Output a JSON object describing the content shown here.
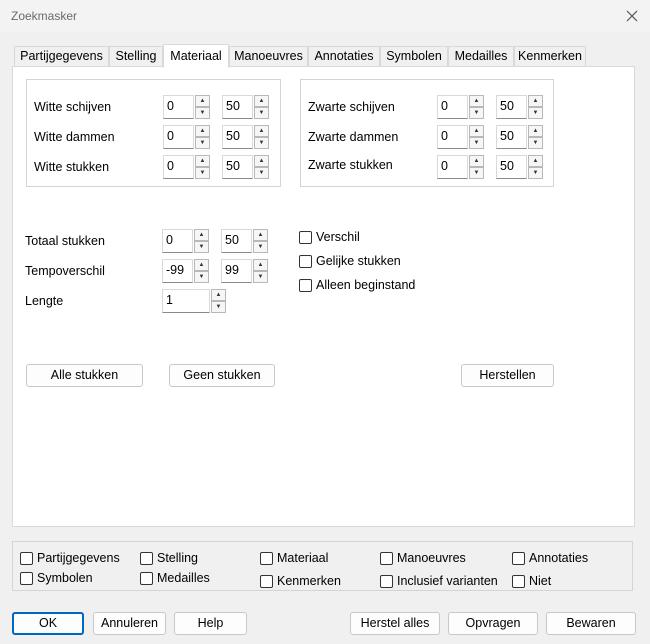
{
  "window": {
    "title": "Zoekmasker"
  },
  "tabs": [
    {
      "label": "Partijgegevens"
    },
    {
      "label": "Stelling"
    },
    {
      "label": "Materiaal"
    },
    {
      "label": "Manoeuvres"
    },
    {
      "label": "Annotaties"
    },
    {
      "label": "Symbolen"
    },
    {
      "label": "Medailles"
    },
    {
      "label": "Kenmerken"
    }
  ],
  "active_tab": "Materiaal",
  "white": {
    "schijven": {
      "label": "Witte schijven",
      "min": "0",
      "max": "50"
    },
    "dammen": {
      "label": "Witte dammen",
      "min": "0",
      "max": "50"
    },
    "stukken": {
      "label": "Witte stukken",
      "min": "0",
      "max": "50"
    }
  },
  "black": {
    "schijven": {
      "label": "Zwarte schijven",
      "min": "0",
      "max": "50"
    },
    "dammen": {
      "label": "Zwarte dammen",
      "min": "0",
      "max": "50"
    },
    "stukken": {
      "label": "Zwarte stukken",
      "min": "0",
      "max": "50"
    }
  },
  "totaal": {
    "label": "Totaal stukken",
    "min": "0",
    "max": "50"
  },
  "tempo": {
    "label": "Tempoverschil",
    "min": "-99",
    "max": "99"
  },
  "lengte": {
    "label": "Lengte",
    "value": "1"
  },
  "options": {
    "verschil": {
      "label": "Verschil",
      "checked": false
    },
    "gelijke": {
      "label": "Gelijke stukken",
      "checked": false
    },
    "alleen": {
      "label": "Alleen beginstand",
      "checked": false
    }
  },
  "buttons": {
    "alle": "Alle stukken",
    "geen": "Geen stukken",
    "herstellen": "Herstellen"
  },
  "filters": [
    {
      "label": "Partijgegevens",
      "checked": false
    },
    {
      "label": "Stelling",
      "checked": false
    },
    {
      "label": "Materiaal",
      "checked": false
    },
    {
      "label": "Manoeuvres",
      "checked": false
    },
    {
      "label": "Annotaties",
      "checked": false
    },
    {
      "label": "Symbolen",
      "checked": false
    },
    {
      "label": "Medailles",
      "checked": false
    },
    {
      "label": "Kenmerken",
      "checked": false
    },
    {
      "label": "Inclusief varianten",
      "checked": false
    },
    {
      "label": "Niet",
      "checked": false
    }
  ],
  "footer": {
    "ok": "OK",
    "annuleren": "Annuleren",
    "help": "Help",
    "herstel_alles": "Herstel alles",
    "opvragen": "Opvragen",
    "bewaren": "Bewaren"
  },
  "icons": {
    "close": "close-icon",
    "up": "arrow-up-icon",
    "down": "arrow-down-icon"
  }
}
